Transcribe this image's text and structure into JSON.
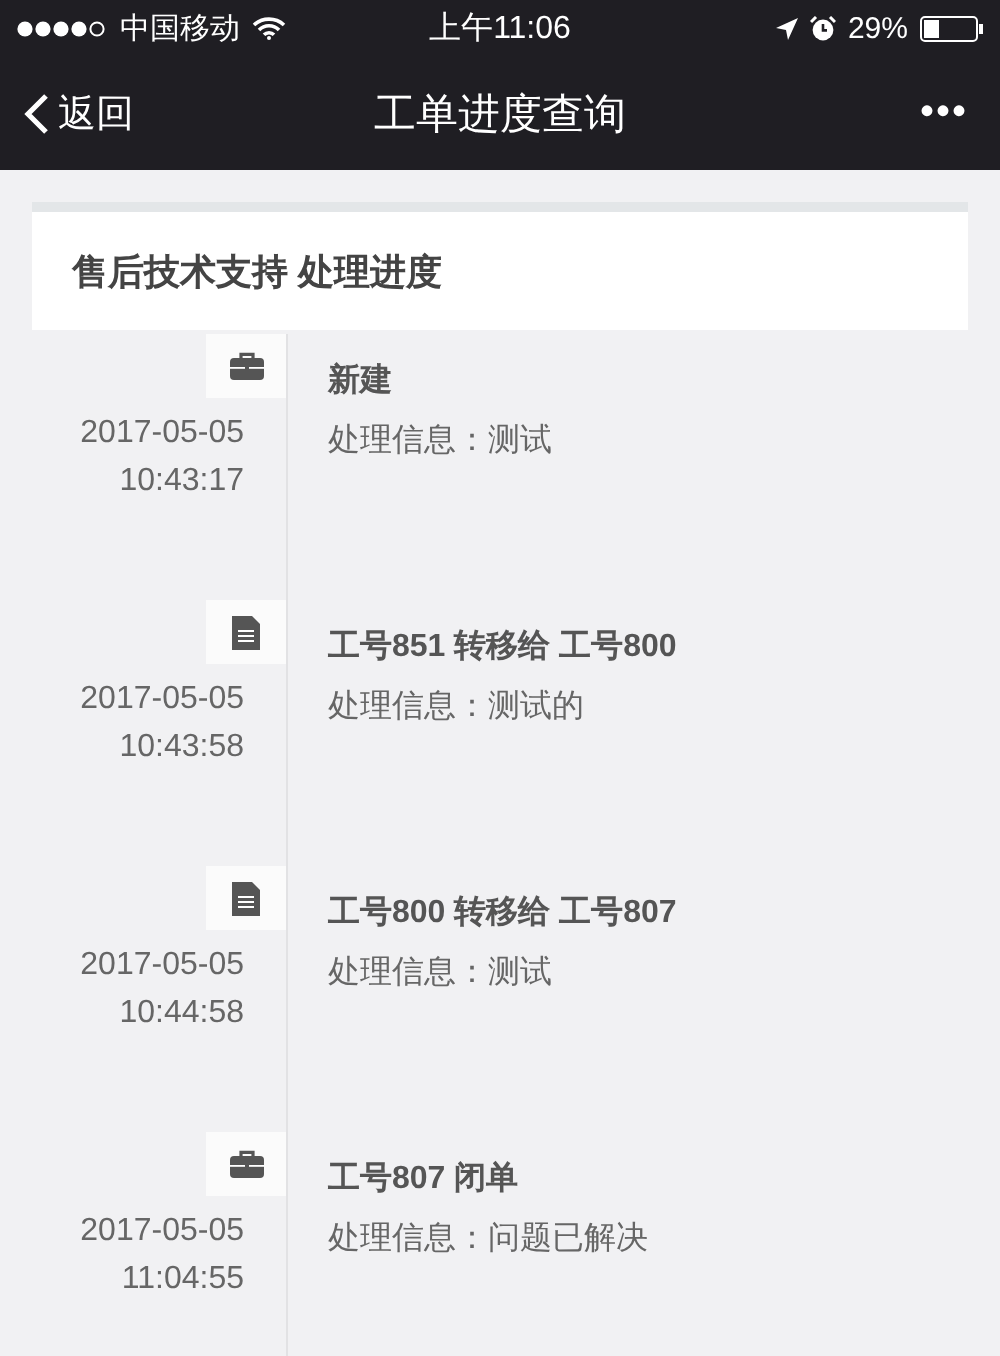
{
  "status_bar": {
    "carrier": "中国移动",
    "time": "上午11:06",
    "battery": "29%"
  },
  "nav_bar": {
    "back": "返回",
    "title": "工单进度查询",
    "more": "•••"
  },
  "card": {
    "title": "售后技术支持 处理进度"
  },
  "timeline": [
    {
      "kind": "briefcase",
      "date": "2017-05-05",
      "time": "10:43:17",
      "title": "新建",
      "info": "处理信息：测试"
    },
    {
      "kind": "document",
      "date": "2017-05-05",
      "time": "10:43:58",
      "title": "工号851 转移给 工号800",
      "info": "处理信息：测试的"
    },
    {
      "kind": "document",
      "date": "2017-05-05",
      "time": "10:44:58",
      "title": "工号800 转移给 工号807",
      "info": "处理信息：测试"
    },
    {
      "kind": "briefcase",
      "date": "2017-05-05",
      "time": "11:04:55",
      "title": "工号807 闭单",
      "info": "处理信息：问题已解决"
    }
  ]
}
